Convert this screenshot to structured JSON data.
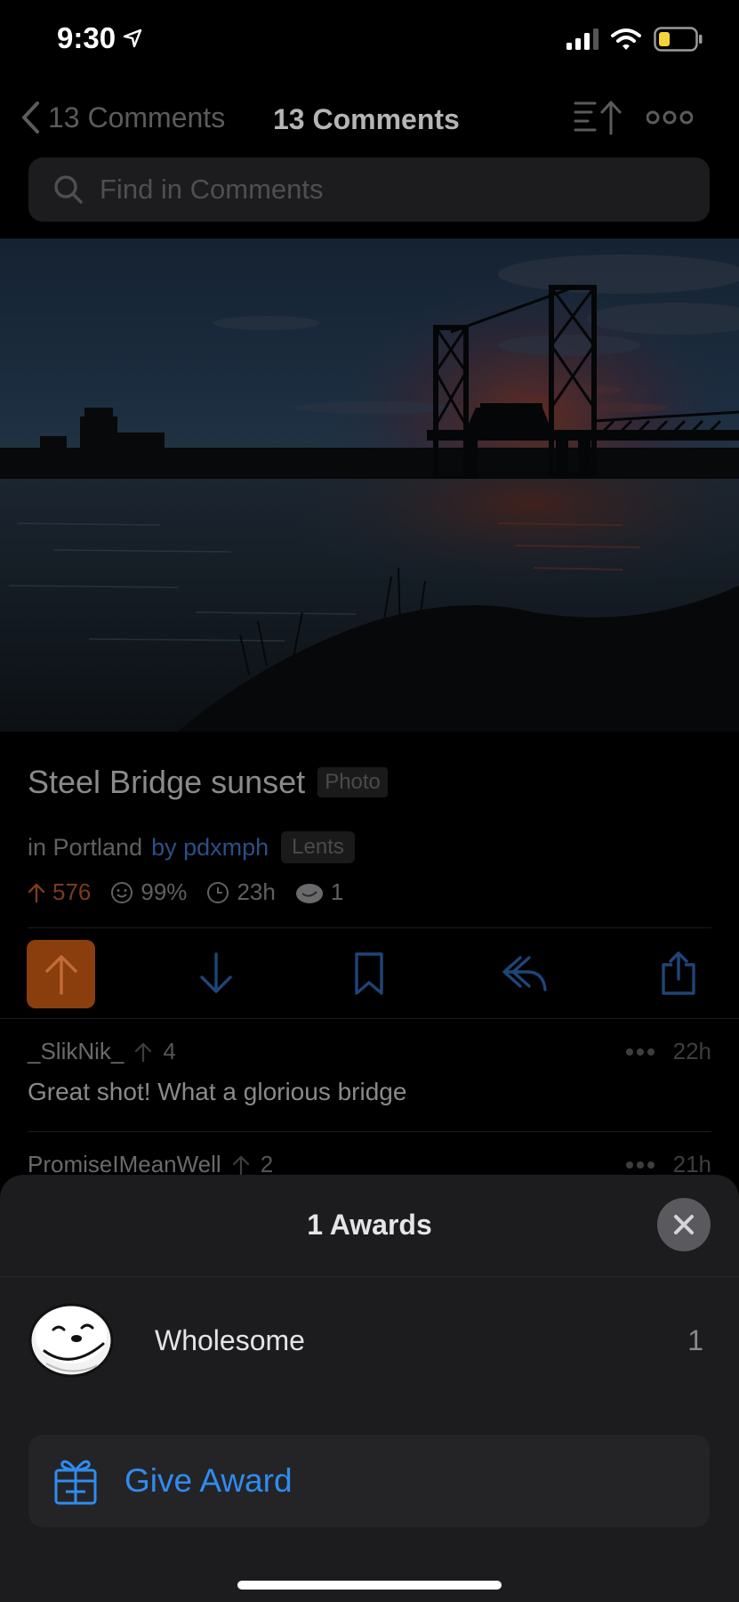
{
  "status_bar": {
    "time": "9:30"
  },
  "nav": {
    "back_label": "13 Comments",
    "title": "13 Comments"
  },
  "search": {
    "placeholder": "Find in Comments"
  },
  "post": {
    "title": "Steel Bridge sunset",
    "flair": "Photo",
    "subreddit_prefix": "in Portland",
    "author_prefix": "by pdxmph",
    "user_flair": "Lents",
    "score": "576",
    "upvote_ratio": "99%",
    "age": "23h",
    "awards_count": "1"
  },
  "comments": [
    {
      "author": "_SlikNik_",
      "score": "4",
      "age": "22h",
      "body": "Great shot! What a glorious bridge"
    },
    {
      "author": "PromiseIMeanWell",
      "score": "2",
      "age": "21h"
    }
  ],
  "sheet": {
    "title": "1 Awards",
    "awards": [
      {
        "name": "Wholesome",
        "count": "1"
      }
    ],
    "give_award_label": "Give Award"
  },
  "colors": {
    "accent_blue": "#2f8cf0",
    "upvote_orange": "#8a3e0e",
    "sheet_bg": "#1c1c1e"
  }
}
